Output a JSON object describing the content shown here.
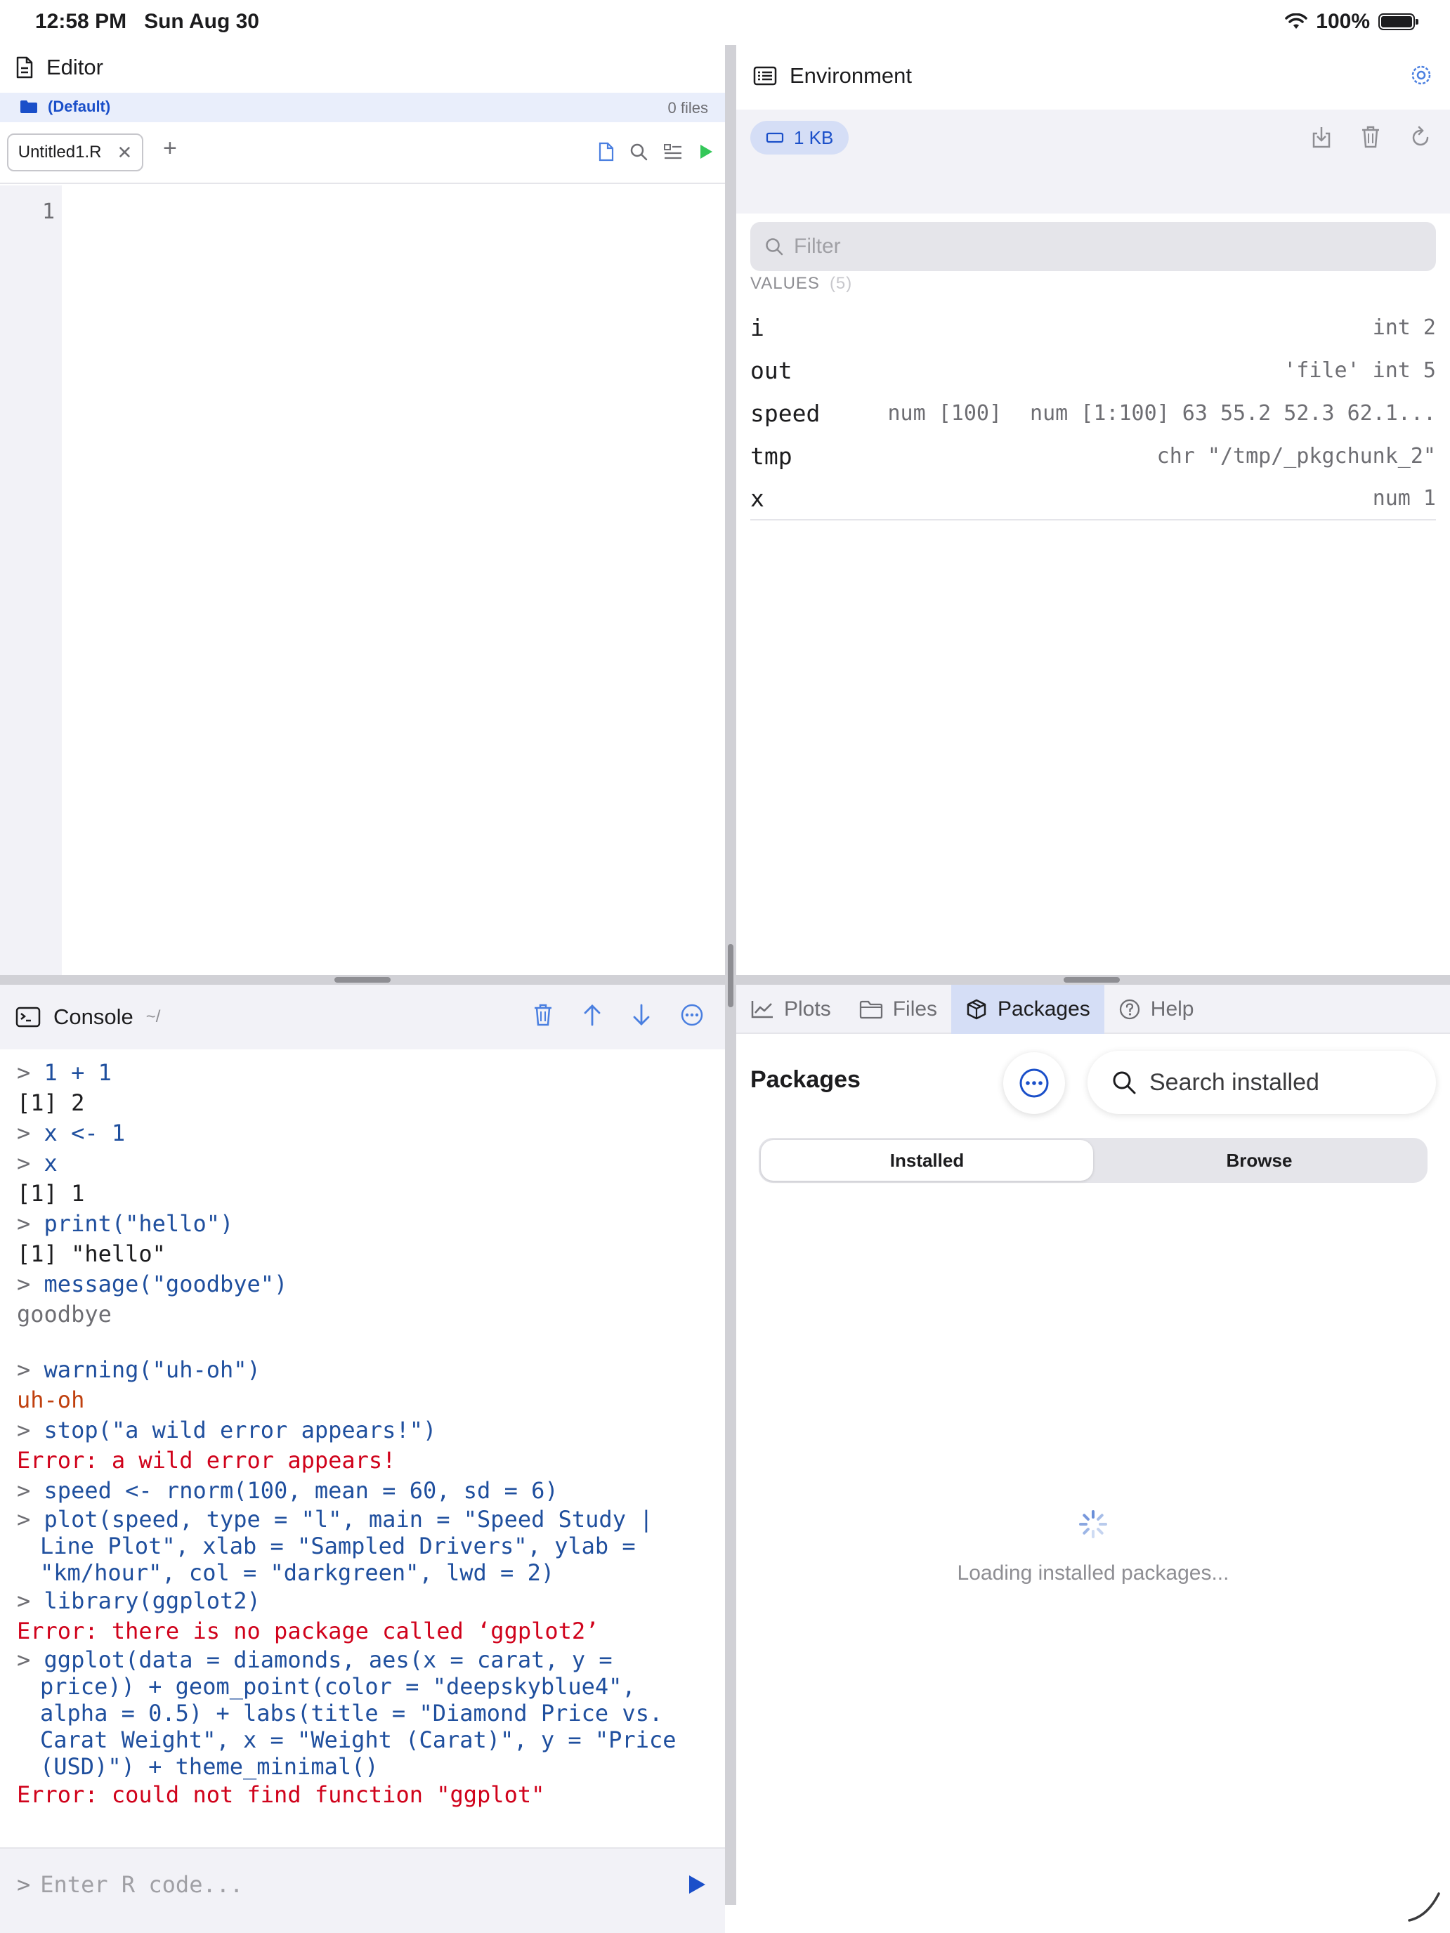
{
  "status": {
    "time": "12:58 PM",
    "date": "Sun Aug 30",
    "battery": "100%"
  },
  "editor": {
    "title": "Editor",
    "project": "(Default)",
    "file_count": "0 files",
    "tab_name": "Untitled1.R",
    "line_numbers": [
      "1"
    ]
  },
  "console": {
    "title": "Console",
    "path": "~/",
    "input_placeholder": "Enter R code...",
    "prompt": ">",
    "lines": [
      {
        "type": "cmd",
        "text": "1 + 1"
      },
      {
        "type": "out",
        "text": "[1] 2"
      },
      {
        "type": "cmd",
        "text": "x <- 1"
      },
      {
        "type": "cmd",
        "text": "x"
      },
      {
        "type": "out",
        "text": "[1] 1"
      },
      {
        "type": "cmd",
        "text": "print(\"hello\")"
      },
      {
        "type": "out",
        "text": "[1] \"hello\""
      },
      {
        "type": "cmd",
        "text": "message(\"goodbye\")"
      },
      {
        "type": "msg",
        "text": "goodbye"
      },
      {
        "type": "blank",
        "text": ""
      },
      {
        "type": "cmd",
        "text": "warning(\"uh-oh\")"
      },
      {
        "type": "warn",
        "text": "uh-oh"
      },
      {
        "type": "cmd",
        "text": "stop(\"a wild error appears!\")"
      },
      {
        "type": "err",
        "text": "Error: a wild error appears!"
      },
      {
        "type": "cmd",
        "text": "speed <- rnorm(100, mean = 60, sd = 6)"
      },
      {
        "type": "cmd",
        "text": "plot(speed, type = \"l\", main = \"Speed Study |"
      },
      {
        "type": "cont",
        "text": "Line Plot\", xlab = \"Sampled Drivers\", ylab ="
      },
      {
        "type": "cont",
        "text": "\"km/hour\", col = \"darkgreen\", lwd = 2)"
      },
      {
        "type": "cmd",
        "text": "library(ggplot2)"
      },
      {
        "type": "err",
        "text": "Error: there is no package called ‘ggplot2’"
      },
      {
        "type": "cmd",
        "text": "ggplot(data = diamonds, aes(x = carat, y ="
      },
      {
        "type": "cont",
        "text": "price)) + geom_point(color = \"deepskyblue4\","
      },
      {
        "type": "cont",
        "text": "alpha = 0.5) + labs(title = \"Diamond Price vs."
      },
      {
        "type": "cont",
        "text": "Carat Weight\", x = \"Weight (Carat)\", y = \"Price"
      },
      {
        "type": "cont",
        "text": "(USD)\") + theme_minimal()"
      },
      {
        "type": "err",
        "text": "Error: could not find function \"ggplot\""
      }
    ]
  },
  "environment": {
    "title": "Environment",
    "memory": "1 KB",
    "filter_placeholder": "Filter",
    "values_label": "VALUES",
    "values_count": "(5)",
    "values": [
      {
        "name": "i",
        "desc": [
          "int 2"
        ]
      },
      {
        "name": "out",
        "desc": [
          "'file' int 5"
        ]
      },
      {
        "name": "speed",
        "desc": [
          "num [100]",
          "num [1:100] 63 55.2 52.3 62.1..."
        ]
      },
      {
        "name": "tmp",
        "desc": [
          "chr \"/tmp/_pkgchunk_2\""
        ]
      },
      {
        "name": "x",
        "desc": [
          "num 1"
        ]
      }
    ]
  },
  "panes": {
    "tabs": [
      {
        "label": "Plots",
        "icon": "chart-icon",
        "active": false
      },
      {
        "label": "Files",
        "icon": "folder-icon",
        "active": false
      },
      {
        "label": "Packages",
        "icon": "package-icon",
        "active": true
      },
      {
        "label": "Help",
        "icon": "help-icon",
        "active": false
      }
    ],
    "packages": {
      "heading": "Packages",
      "search_placeholder": "Search installed",
      "segments": [
        "Installed",
        "Browse"
      ],
      "active_segment": "Installed",
      "loading_text": "Loading installed packages..."
    }
  },
  "colors": {
    "accent": "#1a4fc9",
    "error": "#d0021b",
    "warning": "#c0410f",
    "run": "#34c759"
  }
}
